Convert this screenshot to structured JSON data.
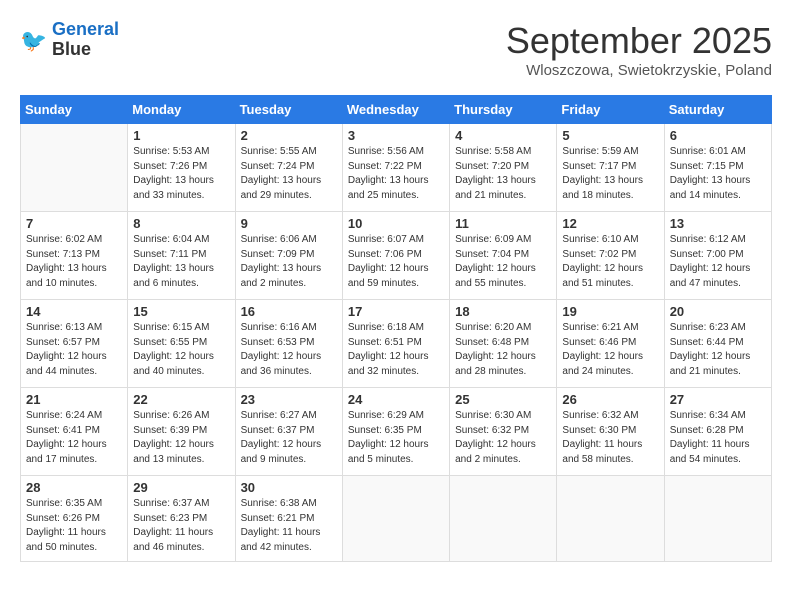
{
  "logo": {
    "line1": "General",
    "line2": "Blue"
  },
  "title": "September 2025",
  "subtitle": "Wloszczowa, Swietokrzyskie, Poland",
  "days_of_week": [
    "Sunday",
    "Monday",
    "Tuesday",
    "Wednesday",
    "Thursday",
    "Friday",
    "Saturday"
  ],
  "weeks": [
    [
      {
        "day": "",
        "info": ""
      },
      {
        "day": "1",
        "info": "Sunrise: 5:53 AM\nSunset: 7:26 PM\nDaylight: 13 hours\nand 33 minutes."
      },
      {
        "day": "2",
        "info": "Sunrise: 5:55 AM\nSunset: 7:24 PM\nDaylight: 13 hours\nand 29 minutes."
      },
      {
        "day": "3",
        "info": "Sunrise: 5:56 AM\nSunset: 7:22 PM\nDaylight: 13 hours\nand 25 minutes."
      },
      {
        "day": "4",
        "info": "Sunrise: 5:58 AM\nSunset: 7:20 PM\nDaylight: 13 hours\nand 21 minutes."
      },
      {
        "day": "5",
        "info": "Sunrise: 5:59 AM\nSunset: 7:17 PM\nDaylight: 13 hours\nand 18 minutes."
      },
      {
        "day": "6",
        "info": "Sunrise: 6:01 AM\nSunset: 7:15 PM\nDaylight: 13 hours\nand 14 minutes."
      }
    ],
    [
      {
        "day": "7",
        "info": "Sunrise: 6:02 AM\nSunset: 7:13 PM\nDaylight: 13 hours\nand 10 minutes."
      },
      {
        "day": "8",
        "info": "Sunrise: 6:04 AM\nSunset: 7:11 PM\nDaylight: 13 hours\nand 6 minutes."
      },
      {
        "day": "9",
        "info": "Sunrise: 6:06 AM\nSunset: 7:09 PM\nDaylight: 13 hours\nand 2 minutes."
      },
      {
        "day": "10",
        "info": "Sunrise: 6:07 AM\nSunset: 7:06 PM\nDaylight: 12 hours\nand 59 minutes."
      },
      {
        "day": "11",
        "info": "Sunrise: 6:09 AM\nSunset: 7:04 PM\nDaylight: 12 hours\nand 55 minutes."
      },
      {
        "day": "12",
        "info": "Sunrise: 6:10 AM\nSunset: 7:02 PM\nDaylight: 12 hours\nand 51 minutes."
      },
      {
        "day": "13",
        "info": "Sunrise: 6:12 AM\nSunset: 7:00 PM\nDaylight: 12 hours\nand 47 minutes."
      }
    ],
    [
      {
        "day": "14",
        "info": "Sunrise: 6:13 AM\nSunset: 6:57 PM\nDaylight: 12 hours\nand 44 minutes."
      },
      {
        "day": "15",
        "info": "Sunrise: 6:15 AM\nSunset: 6:55 PM\nDaylight: 12 hours\nand 40 minutes."
      },
      {
        "day": "16",
        "info": "Sunrise: 6:16 AM\nSunset: 6:53 PM\nDaylight: 12 hours\nand 36 minutes."
      },
      {
        "day": "17",
        "info": "Sunrise: 6:18 AM\nSunset: 6:51 PM\nDaylight: 12 hours\nand 32 minutes."
      },
      {
        "day": "18",
        "info": "Sunrise: 6:20 AM\nSunset: 6:48 PM\nDaylight: 12 hours\nand 28 minutes."
      },
      {
        "day": "19",
        "info": "Sunrise: 6:21 AM\nSunset: 6:46 PM\nDaylight: 12 hours\nand 24 minutes."
      },
      {
        "day": "20",
        "info": "Sunrise: 6:23 AM\nSunset: 6:44 PM\nDaylight: 12 hours\nand 21 minutes."
      }
    ],
    [
      {
        "day": "21",
        "info": "Sunrise: 6:24 AM\nSunset: 6:41 PM\nDaylight: 12 hours\nand 17 minutes."
      },
      {
        "day": "22",
        "info": "Sunrise: 6:26 AM\nSunset: 6:39 PM\nDaylight: 12 hours\nand 13 minutes."
      },
      {
        "day": "23",
        "info": "Sunrise: 6:27 AM\nSunset: 6:37 PM\nDaylight: 12 hours\nand 9 minutes."
      },
      {
        "day": "24",
        "info": "Sunrise: 6:29 AM\nSunset: 6:35 PM\nDaylight: 12 hours\nand 5 minutes."
      },
      {
        "day": "25",
        "info": "Sunrise: 6:30 AM\nSunset: 6:32 PM\nDaylight: 12 hours\nand 2 minutes."
      },
      {
        "day": "26",
        "info": "Sunrise: 6:32 AM\nSunset: 6:30 PM\nDaylight: 11 hours\nand 58 minutes."
      },
      {
        "day": "27",
        "info": "Sunrise: 6:34 AM\nSunset: 6:28 PM\nDaylight: 11 hours\nand 54 minutes."
      }
    ],
    [
      {
        "day": "28",
        "info": "Sunrise: 6:35 AM\nSunset: 6:26 PM\nDaylight: 11 hours\nand 50 minutes."
      },
      {
        "day": "29",
        "info": "Sunrise: 6:37 AM\nSunset: 6:23 PM\nDaylight: 11 hours\nand 46 minutes."
      },
      {
        "day": "30",
        "info": "Sunrise: 6:38 AM\nSunset: 6:21 PM\nDaylight: 11 hours\nand 42 minutes."
      },
      {
        "day": "",
        "info": ""
      },
      {
        "day": "",
        "info": ""
      },
      {
        "day": "",
        "info": ""
      },
      {
        "day": "",
        "info": ""
      }
    ]
  ]
}
